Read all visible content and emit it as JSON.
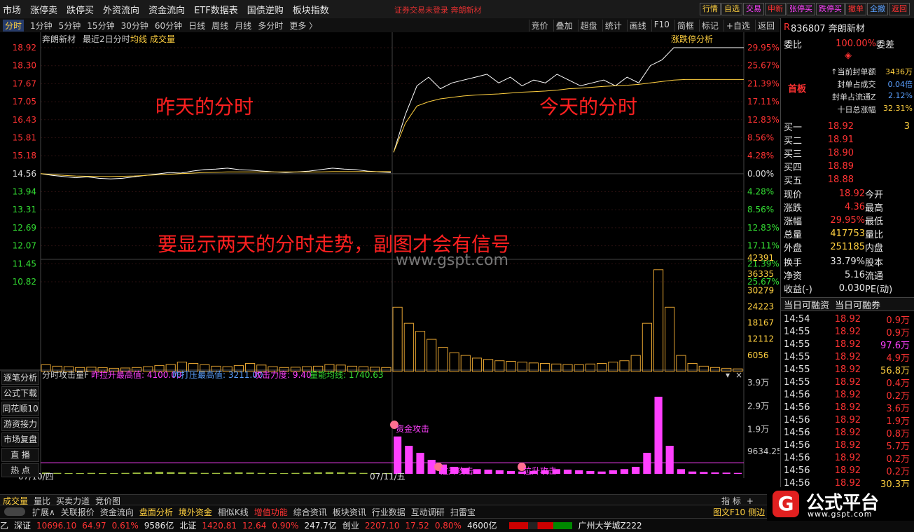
{
  "top_menu": [
    "市场",
    "涨停卖",
    "跌停买",
    "外资流向",
    "资金流向",
    "ETF数据表",
    "国债逆购",
    "板块指数"
  ],
  "top_notice": "证券交易未登录  奔朗新材",
  "top_right_buttons": [
    {
      "label": "行情",
      "color": "#ffd040"
    },
    {
      "label": "自选",
      "color": "#ffd040"
    },
    {
      "label": "交易",
      "color": "#ff40ff"
    },
    {
      "label": "申新",
      "color": "#ff3333"
    },
    {
      "label": "张停买",
      "color": "#ff40ff"
    },
    {
      "label": "跌停买",
      "color": "#ff40ff"
    },
    {
      "label": "撤单",
      "color": "#ff3333"
    },
    {
      "label": "全撤",
      "color": "#5aa0ff"
    },
    {
      "label": "返回",
      "color": "#ff3333"
    }
  ],
  "toolbar_left": [
    "分时",
    "1分钟",
    "5分钟",
    "15分钟",
    "30分钟",
    "60分钟",
    "日线",
    "周线",
    "月线",
    "多分时",
    "更多 〉"
  ],
  "toolbar_right": [
    "竞价",
    "叠加",
    "超盘",
    "统计",
    "画线",
    "F10",
    "简框",
    "标记",
    "+自选",
    "返回"
  ],
  "chart_header": {
    "name": "奔朗新材",
    "subtitle": "最近2日分时",
    "avg_label": "均线",
    "vol_label": "成交量",
    "right_label": "涨跌停分析"
  },
  "annotations": {
    "yesterday": "昨天的分时",
    "today": "今天的分时",
    "note": "要显示两天的分时走势，副图才会有信号",
    "site": "www.gspt.com"
  },
  "chart_data": {
    "type": "line",
    "price_ticks": [
      18.92,
      18.3,
      17.67,
      17.05,
      16.43,
      15.81,
      15.18,
      14.56,
      13.94,
      13.31,
      12.69,
      12.07,
      11.45,
      10.82
    ],
    "pct_ticks": [
      "29.95%",
      "25.67%",
      "21.39%",
      "17.11%",
      "12.83%",
      "8.56%",
      "4.28%",
      "0.00%",
      "4.28%",
      "8.56%",
      "12.83%",
      "17.11%",
      "21.39%",
      "25.67%"
    ],
    "volume_ticks": [
      42391,
      36335,
      30279,
      24223,
      18167,
      12112,
      6056
    ],
    "sub_ticks": [
      "3.9万",
      "2.9万",
      "1.9万",
      "9634.25"
    ],
    "price_ylim": [
      10.82,
      18.92
    ],
    "volume_ylim": [
      0,
      42391
    ],
    "sub_ylim": [
      0,
      39000
    ],
    "x_labels": [
      "07/10/四",
      "07/11/五"
    ],
    "day1_price": [
      14.56,
      14.5,
      14.46,
      14.42,
      14.45,
      14.4,
      14.38,
      14.4,
      14.45,
      14.5,
      14.55,
      14.6,
      14.58,
      14.65,
      14.7,
      14.72,
      14.75,
      14.7,
      14.68,
      14.65,
      14.62,
      14.6,
      14.62,
      14.65,
      14.7,
      14.75,
      14.72,
      14.7,
      14.65,
      14.62,
      14.6
    ],
    "day1_avg": [
      14.56,
      14.53,
      14.5,
      14.48,
      14.47,
      14.46,
      14.46,
      14.47,
      14.48,
      14.5,
      14.52,
      14.54,
      14.56,
      14.58,
      14.6,
      14.61,
      14.62,
      14.62,
      14.62,
      14.62,
      14.62,
      14.62,
      14.62,
      14.62,
      14.62,
      14.63,
      14.63,
      14.63,
      14.63,
      14.63,
      14.63
    ],
    "day2_price": [
      15.3,
      16.6,
      17.6,
      17.9,
      17.5,
      17.7,
      17.8,
      17.9,
      18.0,
      17.7,
      17.9,
      17.6,
      17.8,
      17.7,
      18.0,
      17.8,
      17.6,
      17.7,
      17.8,
      17.6,
      17.9,
      17.7,
      18.3,
      18.5,
      18.92,
      18.92,
      18.92,
      18.92,
      18.92,
      18.92,
      18.92
    ],
    "day2_avg": [
      15.3,
      16.3,
      16.9,
      17.05,
      17.15,
      17.2,
      17.25,
      17.28,
      17.3,
      17.32,
      17.35,
      17.38,
      17.4,
      17.42,
      17.45,
      17.5,
      17.52,
      17.55,
      17.58,
      17.6,
      17.62,
      17.65,
      17.7,
      17.75,
      17.8,
      17.82,
      17.82,
      17.82,
      17.82,
      17.82,
      17.82
    ],
    "day1_volume": [
      2500,
      2000,
      1800,
      1500,
      1600,
      1400,
      1200,
      1300,
      1500,
      1800,
      2200,
      2600,
      3500,
      3000,
      2500,
      2000,
      1800,
      2200,
      3000,
      2400,
      1800,
      1500,
      1600,
      1800,
      2000,
      2600,
      2400,
      2000,
      1800,
      1600,
      1500
    ],
    "day2_volume": [
      24000,
      18000,
      15000,
      12000,
      9000,
      7000,
      6000,
      5000,
      4500,
      4000,
      3800,
      3500,
      3200,
      3000,
      2800,
      2600,
      2500,
      2800,
      3000,
      3500,
      4000,
      6000,
      18000,
      38000,
      24000,
      6000,
      3000,
      2000,
      1500,
      1200,
      1000
    ],
    "sub_values": [
      500,
      400,
      300,
      300,
      400,
      300,
      300,
      400,
      500,
      600,
      800,
      700,
      600,
      500,
      400,
      400,
      500,
      600,
      500,
      400,
      300,
      300,
      400,
      500,
      600,
      700,
      600,
      500,
      400,
      300,
      300,
      16000,
      12000,
      9000,
      6000,
      4000,
      3000,
      2500,
      2000,
      1800,
      1500,
      1200,
      1000,
      1200,
      1500,
      2000,
      1800,
      1500,
      1200,
      1000,
      1500,
      2000,
      3000,
      9000,
      33000,
      12000,
      2000,
      1000,
      800,
      600,
      500,
      400
    ],
    "sub_line_level": 1740.63
  },
  "sub_header": {
    "name": "分时攻击量F",
    "items": [
      {
        "label": "昨拉升最高值: 4100.00",
        "color": "#ff40ff"
      },
      {
        "label": "昨打压最高值: 3211.00",
        "color": "#5aa0ff"
      },
      {
        "label": "攻击力度: 9.40",
        "color": "#ff40ff"
      },
      {
        "label": "量能均线: 1740.63",
        "color": "#33dd33"
      }
    ]
  },
  "sub_signals": [
    "资金攻击",
    "拉升攻击",
    "拉升攻击"
  ],
  "side_tabs": [
    "逐笔分析",
    "公式下载",
    "同花顺10",
    "游资接力",
    "市场复盘",
    "直 播",
    "热 点"
  ],
  "stock": {
    "code": "836807",
    "name": "奔朗新材",
    "weibi_label": "委比",
    "weibi": "100.00%",
    "weicha_label": "委差",
    "board": "首板",
    "seal_rows": [
      {
        "label": "↑当前封单额",
        "value": "3436万"
      },
      {
        "label": "封单占成交",
        "value": "0.04倍"
      },
      {
        "label": "封单占流通Z",
        "value": "2.12%"
      },
      {
        "label": "十日总涨幅",
        "value": "32.31%"
      }
    ],
    "buy": [
      {
        "label": "买一",
        "price": "18.92",
        "vol": "3"
      },
      {
        "label": "买二",
        "price": "18.91",
        "vol": ""
      },
      {
        "label": "买三",
        "price": "18.90",
        "vol": ""
      },
      {
        "label": "买四",
        "price": "18.89",
        "vol": ""
      },
      {
        "label": "买五",
        "price": "18.88",
        "vol": ""
      }
    ],
    "quotes": [
      {
        "l1": "现价",
        "v1": "18.92",
        "l2": "今开",
        "c1": "red"
      },
      {
        "l1": "涨跌",
        "v1": "4.36",
        "l2": "最高",
        "c1": "red"
      },
      {
        "l1": "涨幅",
        "v1": "29.95%",
        "l2": "最低",
        "c1": "red"
      },
      {
        "l1": "总量",
        "v1": "417753",
        "l2": "量比",
        "c1": "yellow"
      },
      {
        "l1": "外盘",
        "v1": "251185",
        "l2": "内盘",
        "c1": "yellow"
      },
      {
        "l1": "换手",
        "v1": "33.79%",
        "l2": "股本",
        "c1": "white"
      },
      {
        "l1": "净资",
        "v1": "5.16",
        "l2": "流通",
        "c1": "white"
      },
      {
        "l1": "收益(-)",
        "v1": "0.030",
        "l2": "PE(动)",
        "c1": "white"
      }
    ],
    "margin_tabs": [
      "当日可融资",
      "当日可融券"
    ],
    "ticks": [
      {
        "t": "14:54",
        "p": "18.92",
        "v": "0.9万",
        "c": "red"
      },
      {
        "t": "14:55",
        "p": "18.92",
        "v": "0.9万",
        "c": "red"
      },
      {
        "t": "14:55",
        "p": "18.92",
        "v": "97.6万",
        "c": "magenta"
      },
      {
        "t": "14:55",
        "p": "18.92",
        "v": "4.9万",
        "c": "red"
      },
      {
        "t": "14:55",
        "p": "18.92",
        "v": "56.8万",
        "c": "yellow"
      },
      {
        "t": "14:55",
        "p": "18.92",
        "v": "0.4万",
        "c": "red"
      },
      {
        "t": "14:56",
        "p": "18.92",
        "v": "0.2万",
        "c": "red"
      },
      {
        "t": "14:56",
        "p": "18.92",
        "v": "3.6万",
        "c": "red"
      },
      {
        "t": "14:56",
        "p": "18.92",
        "v": "1.9万",
        "c": "red"
      },
      {
        "t": "14:56",
        "p": "18.92",
        "v": "0.8万",
        "c": "red"
      },
      {
        "t": "14:56",
        "p": "18.92",
        "v": "5.7万",
        "c": "red"
      },
      {
        "t": "14:56",
        "p": "18.92",
        "v": "0.2万",
        "c": "red"
      },
      {
        "t": "14:56",
        "p": "18.92",
        "v": "0.2万",
        "c": "red"
      },
      {
        "t": "14:56",
        "p": "18.92",
        "v": "30.3万",
        "c": "yellow"
      }
    ]
  },
  "bottom_tabs": [
    "成交量",
    "量比",
    "买卖力道",
    "竞价图"
  ],
  "bottom_right": [
    "指 标",
    "+"
  ],
  "bottom_tabs2": [
    "扩展∧",
    "关联报价",
    "资金流向",
    "盘面分析",
    "境外资金",
    "相似K线",
    "增值功能",
    "综合资讯",
    "板块资讯",
    "行业数据",
    "互动调研",
    "扫雷宝"
  ],
  "bottom_tabs2_right": [
    "图文F10",
    "侧边栏"
  ],
  "status": [
    {
      "text": "乙",
      "c": "white"
    },
    {
      "text": "深证",
      "c": "white"
    },
    {
      "text": "10696.10",
      "c": "red"
    },
    {
      "text": "64.97",
      "c": "red"
    },
    {
      "text": "0.61%",
      "c": "red"
    },
    {
      "text": "9586亿",
      "c": "white"
    },
    {
      "text": "北证",
      "c": "white"
    },
    {
      "text": "1420.81",
      "c": "red"
    },
    {
      "text": "12.64",
      "c": "red"
    },
    {
      "text": "0.90%",
      "c": "red"
    },
    {
      "text": "247.7亿",
      "c": "white"
    },
    {
      "text": "创业",
      "c": "white"
    },
    {
      "text": "2207.10",
      "c": "red"
    },
    {
      "text": "17.52",
      "c": "red"
    },
    {
      "text": "0.80%",
      "c": "red"
    },
    {
      "text": "4600亿",
      "c": "white"
    },
    {
      "text": "广州大学城Z222",
      "c": "white"
    }
  ],
  "logo": {
    "text": "公式平台",
    "url_text": "www.gspt.com"
  }
}
